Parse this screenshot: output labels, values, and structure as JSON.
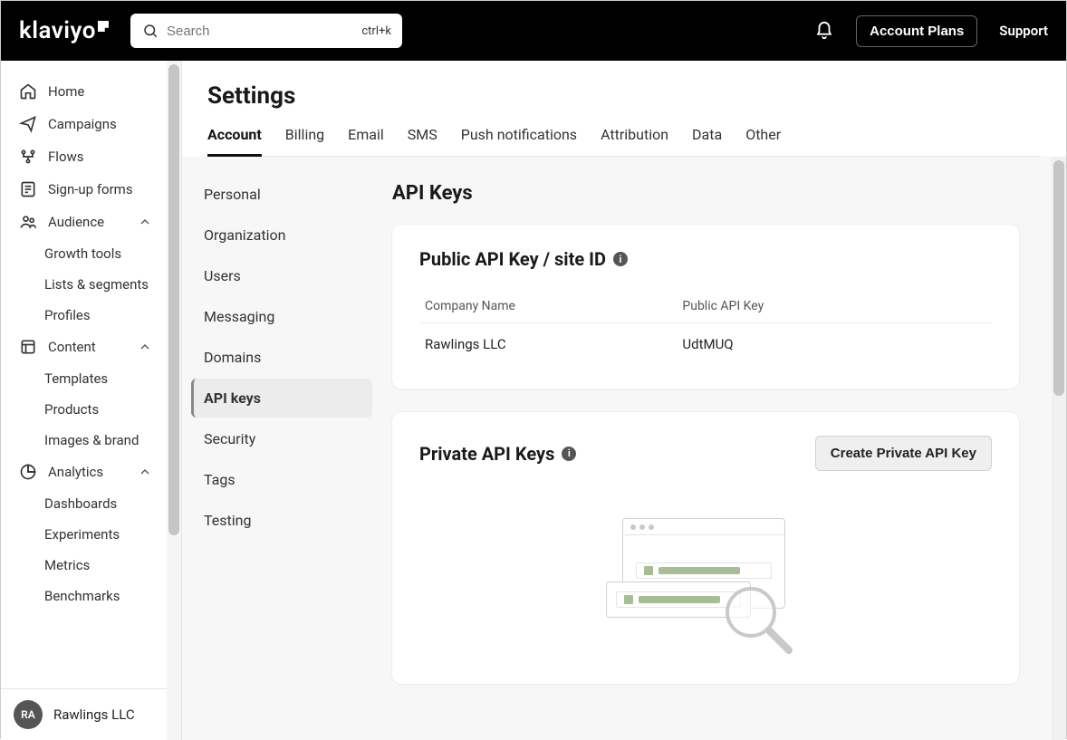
{
  "search": {
    "placeholder": "Search",
    "shortcut": "ctrl+k"
  },
  "topbar": {
    "account_plans": "Account Plans",
    "support": "Support"
  },
  "sidebar": {
    "items": [
      {
        "label": "Home"
      },
      {
        "label": "Campaigns"
      },
      {
        "label": "Flows"
      },
      {
        "label": "Sign-up forms"
      },
      {
        "label": "Audience",
        "children": [
          "Growth tools",
          "Lists & segments",
          "Profiles"
        ]
      },
      {
        "label": "Content",
        "children": [
          "Templates",
          "Products",
          "Images & brand"
        ]
      },
      {
        "label": "Analytics",
        "children": [
          "Dashboards",
          "Experiments",
          "Metrics",
          "Benchmarks"
        ]
      }
    ]
  },
  "footer": {
    "avatar": "RA",
    "company": "Rawlings LLC"
  },
  "settings": {
    "title": "Settings",
    "tabs": [
      "Account",
      "Billing",
      "Email",
      "SMS",
      "Push notifications",
      "Attribution",
      "Data",
      "Other"
    ],
    "active_tab": "Account",
    "subnav": [
      "Personal",
      "Organization",
      "Users",
      "Messaging",
      "Domains",
      "API keys",
      "Security",
      "Tags",
      "Testing"
    ],
    "active_sub": "API keys"
  },
  "api": {
    "heading": "API Keys",
    "public": {
      "title": "Public API Key / site ID",
      "columns": [
        "Company Name",
        "Public API Key"
      ],
      "row": {
        "company": "Rawlings LLC",
        "key": "UdtMUQ"
      }
    },
    "private": {
      "title": "Private API Keys",
      "create_label": "Create Private API Key"
    }
  }
}
